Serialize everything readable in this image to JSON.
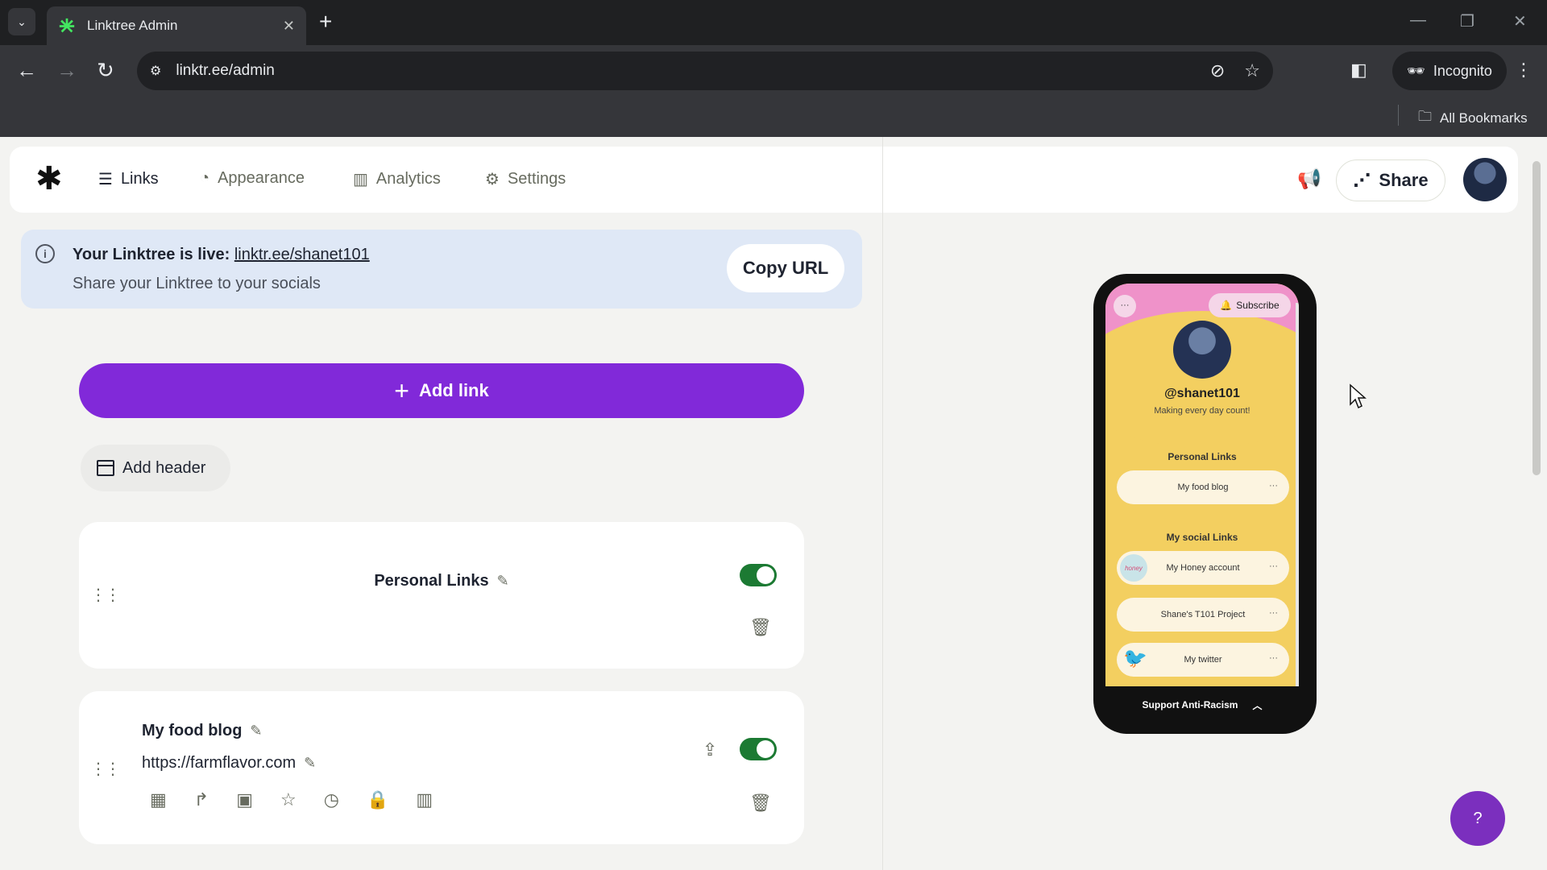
{
  "browser": {
    "tab_title": "Linktree Admin",
    "url": "linktr.ee/admin",
    "incognito_label": "Incognito",
    "all_bookmarks_label": "All Bookmarks"
  },
  "nav": {
    "items": [
      {
        "label": "Links",
        "icon": "list-icon"
      },
      {
        "label": "Appearance",
        "icon": "shapes-icon"
      },
      {
        "label": "Analytics",
        "icon": "bar-chart-icon"
      },
      {
        "label": "Settings",
        "icon": "gear-icon"
      }
    ],
    "share_label": "Share"
  },
  "banner": {
    "live_text": "Your Linktree is live:",
    "live_url": "linktr.ee/shanet101",
    "sub_text": "Share your Linktree to your socials",
    "copy_label": "Copy URL"
  },
  "actions": {
    "add_link": "Add link",
    "add_header": "Add header"
  },
  "cards": [
    {
      "type": "header",
      "title": "Personal Links",
      "enabled": true
    },
    {
      "type": "link",
      "title": "My food blog",
      "url": "https://farmflavor.com",
      "enabled": true
    }
  ],
  "preview": {
    "subscribe_label": "Subscribe",
    "handle": "@shanet101",
    "bio": "Making every day count!",
    "section1": "Personal Links",
    "links1": [
      {
        "label": "My food blog"
      }
    ],
    "section2": "My social Links",
    "links2": [
      {
        "label": "My Honey account",
        "thumb_text": "honey"
      },
      {
        "label": "Shane's T101 Project"
      },
      {
        "label": "My twitter"
      }
    ],
    "footer": "Support Anti-Racism"
  },
  "colors": {
    "accent": "#8129d9",
    "toggle_on": "#1c7a33",
    "banner_bg": "#dfe8f6",
    "preview_top": "#ef92c9",
    "preview_bg": "#f3cf60"
  }
}
